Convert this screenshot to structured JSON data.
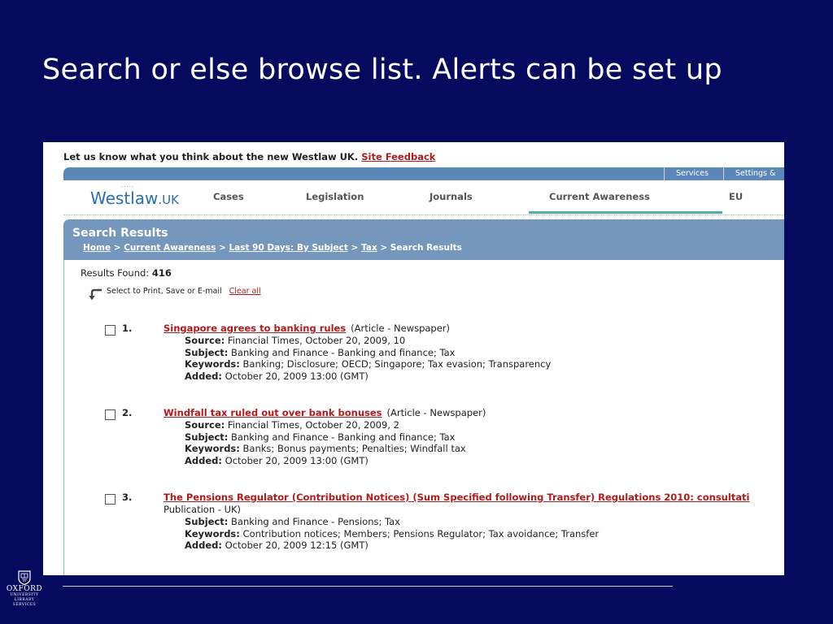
{
  "slide": {
    "title": "Search or else browse list. Alerts can be set up"
  },
  "feedback": {
    "text": "Let us know what you think about the new Westlaw UK.",
    "link": "Site Feedback"
  },
  "topbar": {
    "services": "Services",
    "settings": "Settings &"
  },
  "nav": {
    "logo_main": "Westlaw",
    "logo_suffix": ".UK",
    "tabs": [
      "Cases",
      "Legislation",
      "Journals",
      "Current Awareness",
      "EU"
    ],
    "active_tab": "Current Awareness"
  },
  "panel": {
    "title": "Search Results",
    "breadcrumbs": [
      "Home",
      "Current Awareness",
      "Last 90 Days: By Subject",
      "Tax"
    ],
    "current": "Search Results",
    "separator": ">"
  },
  "results": {
    "found_label": "Results Found:",
    "found_count": "416",
    "select_text": "Select to Print, Save or E-mail",
    "clear_all": "Clear all",
    "items": [
      {
        "num": "1.",
        "title": "Singapore agrees to banking rules",
        "type": "(Article - Newspaper)",
        "details": [
          {
            "label": "Source:",
            "value": "Financial Times, October 20, 2009, 10"
          },
          {
            "label": "Subject:",
            "value": "Banking and Finance - Banking and finance; Tax"
          },
          {
            "label": "Keywords:",
            "value": "Banking; Disclosure; OECD; Singapore; Tax evasion; Transparency"
          },
          {
            "label": "Added:",
            "value": "October 20, 2009 13:00 (GMT)"
          }
        ]
      },
      {
        "num": "2.",
        "title": "Windfall tax ruled out over bank bonuses",
        "type": "(Article - Newspaper)",
        "details": [
          {
            "label": "Source:",
            "value": "Financial Times, October 20, 2009, 2"
          },
          {
            "label": "Subject:",
            "value": "Banking and Finance - Banking and finance; Tax"
          },
          {
            "label": "Keywords:",
            "value": "Banks; Bonus payments; Penalties; Windfall tax"
          },
          {
            "label": "Added:",
            "value": "October 20, 2009 13:00 (GMT)"
          }
        ]
      },
      {
        "num": "3.",
        "title": "The Pensions Regulator (Contribution Notices) (Sum Specified following Transfer) Regulations 2010: consultati",
        "type": "Publication - UK)",
        "details": [
          {
            "label": "Subject:",
            "value": "Banking and Finance - Pensions; Tax"
          },
          {
            "label": "Keywords:",
            "value": "Contribution notices; Members; Pensions Regulator; Tax avoidance; Transfer"
          },
          {
            "label": "Added:",
            "value": "October 20, 2009 12:15 (GMT)"
          }
        ]
      }
    ]
  },
  "logo": {
    "line1": "OXFORD",
    "line2": "UNIVERSITY",
    "line3": "LIBRARY",
    "line4": "SERVICES"
  },
  "colors": {
    "background": "#050a5e",
    "link_red": "#b01c1c",
    "header_blue": "#5a87b8",
    "panel_blue": "#7596bd",
    "active_underline": "#4db0a8"
  }
}
